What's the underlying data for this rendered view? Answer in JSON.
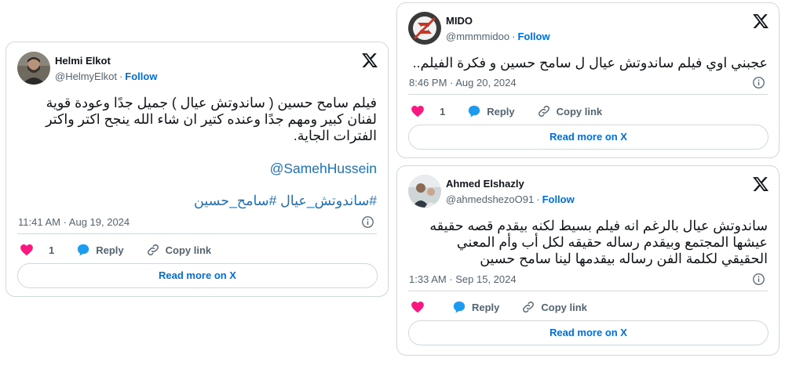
{
  "tweets": [
    {
      "id": "helmi",
      "name": "Helmi Elkot",
      "handle": "@HelmyElkot",
      "follow_label": "Follow",
      "text_lines": [
        "فيلم سامح حسين ( ساندوتش عيال ) جميل جدًا وعودة قوية",
        "لفنان كبير ومهم جدًا وعنده كتير ان شاء الله ينجح اكتر واكتر",
        "الفترات الجاية."
      ],
      "mention": "@SamehHussein",
      "hashtags": "#ساندوتش_عيال #سامح_حسين",
      "timestamp": "11:41 AM · Aug 19, 2024",
      "like_count": "1",
      "reply_label": "Reply",
      "copy_label": "Copy link",
      "read_more_label": "Read more on X"
    },
    {
      "id": "mido",
      "name": "MIDO",
      "handle": "@mmmmidoo",
      "follow_label": "Follow",
      "text_lines": [
        "عجبني اوي فيلم ساندوتش عيال ل سامح حسين و فكرة الفيلم.."
      ],
      "timestamp": "8:46 PM · Aug 20, 2024",
      "like_count": "1",
      "reply_label": "Reply",
      "copy_label": "Copy link",
      "read_more_label": "Read more on X"
    },
    {
      "id": "ahmed",
      "name": "Ahmed Elshazly",
      "handle": "@ahmedshezoO91",
      "follow_label": "Follow",
      "text_lines": [
        "ساندوتش عيال بالرغم انه فيلم بسيط  لكنه بيقدم قصه حقيقه",
        "عيشها المجتمع وبيقدم رساله حقيقه لكل أب وأم المعني",
        "الحقيقي لكلمة الفن رساله بيقدمها لينا سامح حسين"
      ],
      "timestamp": "1:33 AM · Sep 15, 2024",
      "like_count": "",
      "reply_label": "Reply",
      "copy_label": "Copy link",
      "read_more_label": "Read more on X"
    }
  ],
  "colors": {
    "border": "#cfd9de",
    "link": "#006fd6",
    "heart": "#f91880",
    "reply_bubble": "#1d9bf0",
    "muted": "#536471"
  }
}
